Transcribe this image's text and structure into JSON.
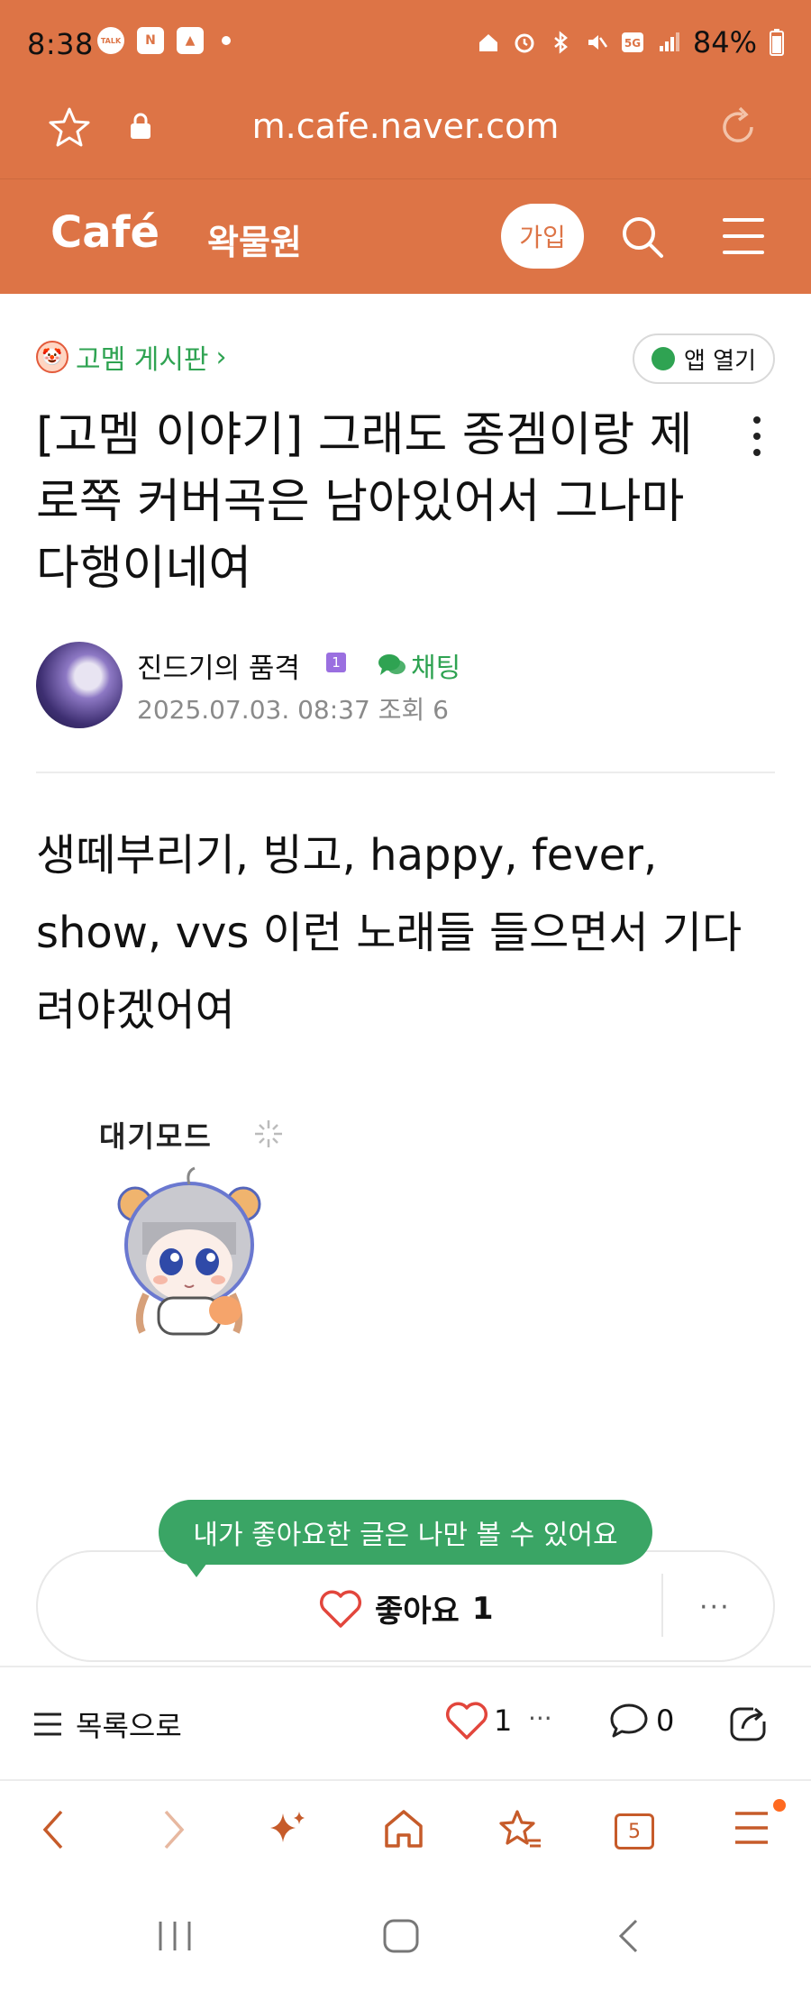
{
  "status_bar": {
    "time": "8:38",
    "battery": "84%",
    "left_icons": [
      "talk-icon",
      "n-icon",
      "gallery-icon",
      "dot-icon"
    ],
    "right_icons": [
      "home-icon",
      "alarm-icon",
      "bluetooth-icon",
      "mute-icon",
      "5g-icon",
      "signal-icon",
      "battery-icon"
    ]
  },
  "browser": {
    "url": "m.cafe.naver.com"
  },
  "cafe_header": {
    "logo": "Café",
    "cafe_name": "왁물원",
    "join_label": "가입"
  },
  "post": {
    "board_name": "고멤 게시판",
    "board_chevron": "›",
    "app_open_label": "앱 열기",
    "title": "[고멤 이야기] 그래도 종겜이랑 제로쪽 커버곡은 남아있어서 그나마 다행이네여",
    "author": {
      "name": "진드기의 품격",
      "level": "1",
      "chat_label": "채팅"
    },
    "date": "2025.07.03. 08:37",
    "views_label": "조회 6",
    "body": "생떼부리기, 빙고, happy, fever, show, vvs 이런 노래들 들으면서 기다려야겠어여",
    "sticker_text": "대기모드"
  },
  "like_section": {
    "tooltip": "내가 좋아요한 글은 나만 볼 수 있어요",
    "like_label": "좋아요",
    "like_count": "1",
    "more_label": "···"
  },
  "content_bar": {
    "list_label": "목록으로",
    "like_count": "1",
    "dots": "···",
    "comment_count": "0"
  },
  "browser_nav": {
    "tab_count": "5"
  },
  "colors": {
    "brand_orange": "#dd7446",
    "green": "#2fa352",
    "tooltip_green": "#3aa565",
    "heart_red": "#e2463c"
  }
}
